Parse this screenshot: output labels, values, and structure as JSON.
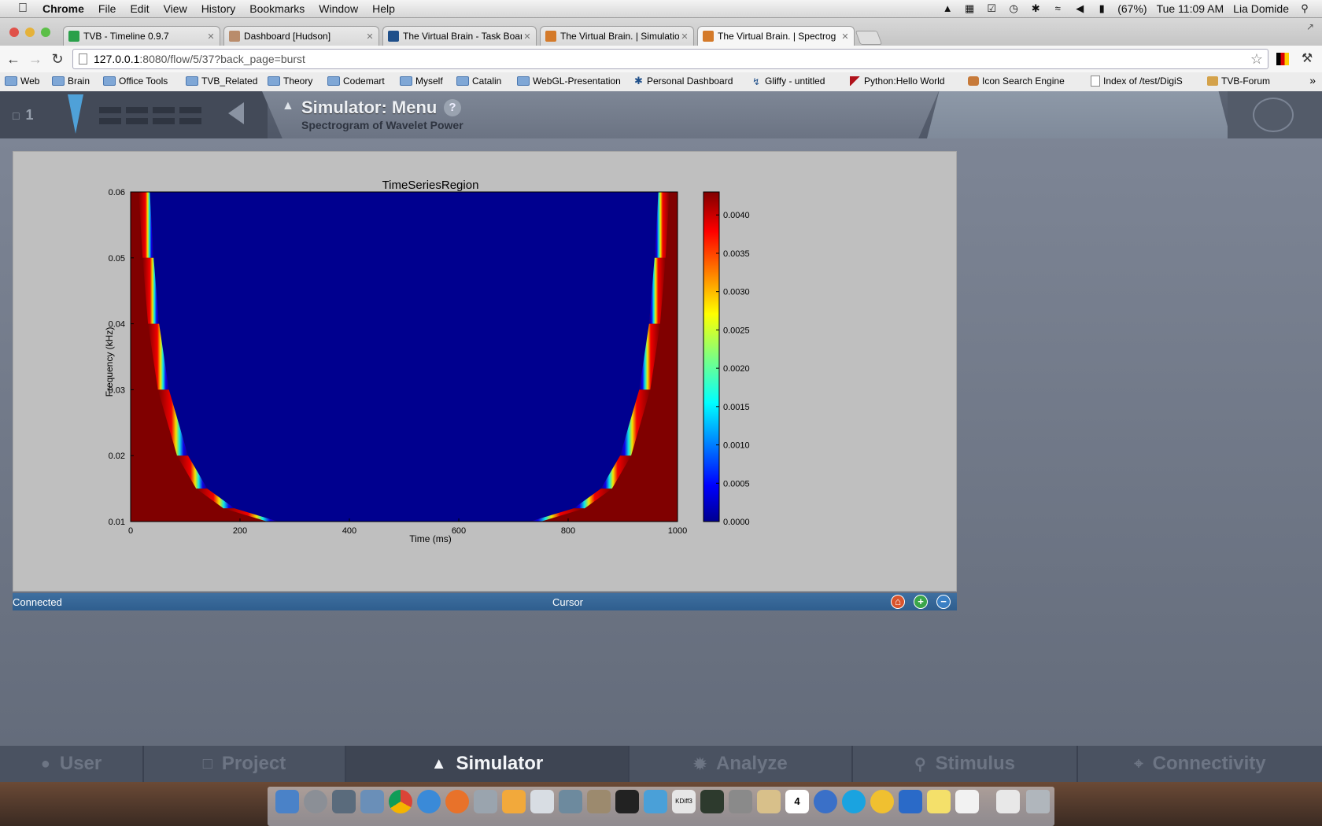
{
  "menubar": {
    "apple_icon": "apple-icon",
    "items": [
      "Chrome",
      "File",
      "Edit",
      "View",
      "History",
      "Bookmarks",
      "Window",
      "Help"
    ],
    "battery": "(67%)",
    "clock": "Tue 11:09 AM",
    "user": "Lia Domide"
  },
  "tabs": [
    {
      "label": "TVB - Timeline 0.9.7",
      "favicon_color": "#2aa04a"
    },
    {
      "label": "Dashboard [Hudson]",
      "favicon_color": "#b98c6b"
    },
    {
      "label": "The Virtual Brain - Task Boar",
      "favicon_color": "#1f4f8a"
    },
    {
      "label": "The Virtual Brain. | Simulatio",
      "favicon_color": "#d47a2a"
    },
    {
      "label": "The Virtual Brain. | Spectrog",
      "favicon_color": "#d47a2a"
    }
  ],
  "toolbar": {
    "url_host": "127.0.0.1",
    "url_rest": ":8080/flow/5/37?back_page=burst"
  },
  "bookmarks": [
    {
      "label": "Web",
      "type": "folder"
    },
    {
      "label": "Brain",
      "type": "folder"
    },
    {
      "label": "Office Tools",
      "type": "folder"
    },
    {
      "label": "TVB_Related",
      "type": "folder"
    },
    {
      "label": "Theory",
      "type": "folder"
    },
    {
      "label": "Codemart",
      "type": "folder"
    },
    {
      "label": "Myself",
      "type": "folder"
    },
    {
      "label": "Catalin",
      "type": "folder"
    },
    {
      "label": "WebGL-Presentation",
      "type": "folder"
    },
    {
      "label": "Personal Dashboard",
      "type": "link"
    },
    {
      "label": "Gliffy - untitled",
      "type": "link"
    },
    {
      "label": "Python:Hello World",
      "type": "link"
    },
    {
      "label": "Icon Search Engine",
      "type": "link"
    },
    {
      "label": "Index of /test/DigiS",
      "type": "link"
    },
    {
      "label": "TVB-Forum",
      "type": "link"
    }
  ],
  "header": {
    "page_count": "1",
    "title": "Simulator: Menu",
    "help": "?",
    "subtitle": "Spectrogram of Wavelet Power"
  },
  "chart_data": {
    "type": "heatmap",
    "title": "TimeSeriesRegion",
    "xlabel": "Time (ms)",
    "ylabel": "Frequency (kHz)",
    "xlim": [
      0,
      1000
    ],
    "ylim": [
      0.01,
      0.06
    ],
    "x_ticks": [
      "0",
      "200",
      "400",
      "600",
      "800",
      "1000"
    ],
    "y_ticks": [
      "0.01",
      "0.02",
      "0.03",
      "0.04",
      "0.05",
      "0.06"
    ],
    "colorbar": {
      "min": 0.0,
      "max": 0.0043,
      "ticks": [
        "0.0000",
        "0.0005",
        "0.0010",
        "0.0015",
        "0.0020",
        "0.0025",
        "0.0030",
        "0.0035",
        "0.0040"
      ],
      "colormap": "jet"
    },
    "description_values": {
      "edge_boundary_left": [
        {
          "freq": 0.06,
          "time": 35
        },
        {
          "freq": 0.05,
          "time": 42
        },
        {
          "freq": 0.04,
          "time": 52
        },
        {
          "freq": 0.03,
          "time": 70
        },
        {
          "freq": 0.02,
          "time": 105
        },
        {
          "freq": 0.015,
          "time": 140
        },
        {
          "freq": 0.012,
          "time": 190
        },
        {
          "freq": 0.01,
          "time": 270
        }
      ],
      "edge_boundary_right": [
        {
          "freq": 0.06,
          "time": 965
        },
        {
          "freq": 0.05,
          "time": 958
        },
        {
          "freq": 0.04,
          "time": 948
        },
        {
          "freq": 0.03,
          "time": 930
        },
        {
          "freq": 0.02,
          "time": 895
        },
        {
          "freq": 0.015,
          "time": 860
        },
        {
          "freq": 0.012,
          "time": 810
        },
        {
          "freq": 0.01,
          "time": 730
        }
      ]
    }
  },
  "status": {
    "left": "Connected",
    "center": "Cursor"
  },
  "bottomnav": [
    {
      "label": "User",
      "icon": "user-icon"
    },
    {
      "label": "Project",
      "icon": "document-icon"
    },
    {
      "label": "Simulator",
      "icon": "rocket-icon",
      "active": true
    },
    {
      "label": "Analyze",
      "icon": "gear-icon"
    },
    {
      "label": "Stimulus",
      "icon": "pin-icon"
    },
    {
      "label": "Connectivity",
      "icon": "network-icon"
    }
  ],
  "dock": {
    "calendar_day": "4",
    "kdiff_label": "KDiff3"
  },
  "colors": {
    "accent": "#4fa1d8",
    "statusbar": "#35659a",
    "heat_low": "#00008f",
    "heat_high": "#800000"
  }
}
